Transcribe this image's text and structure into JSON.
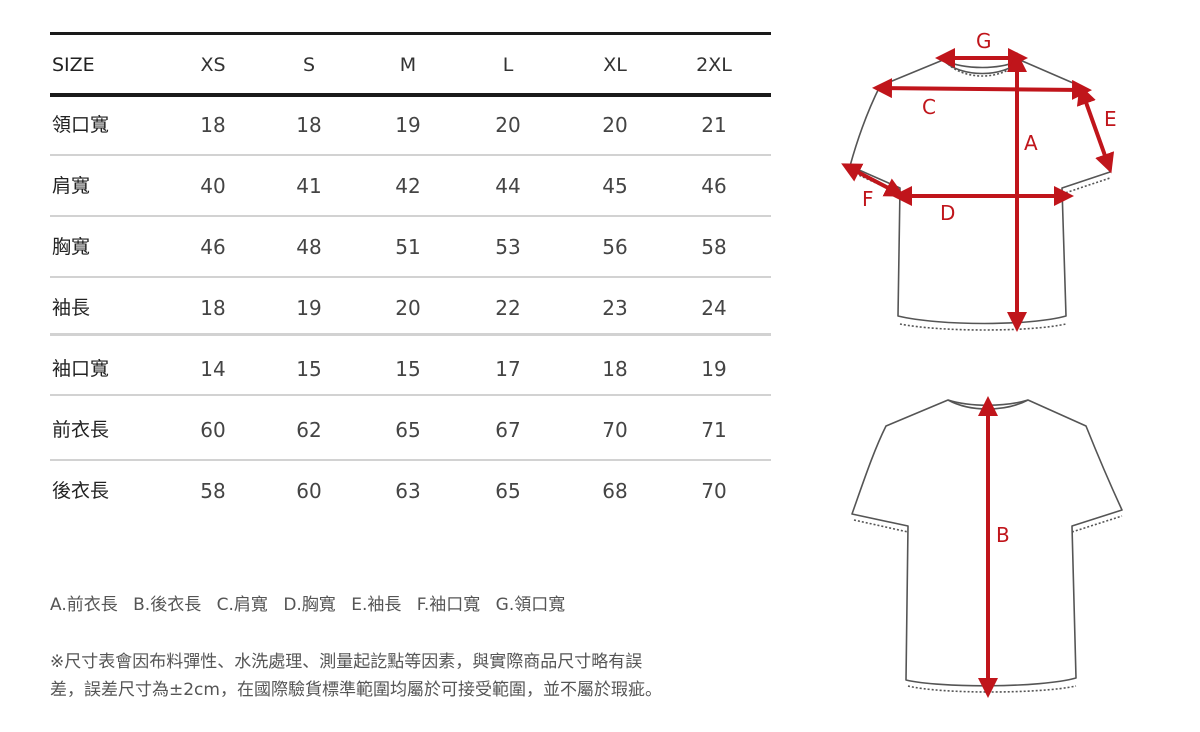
{
  "size_chart": {
    "header": {
      "label": "SIZE",
      "sizes": [
        "XS",
        "S",
        "M",
        "L",
        "XL",
        "2XL"
      ]
    },
    "rows": [
      {
        "label": "領口寬",
        "values": [
          "18",
          "18",
          "19",
          "20",
          "20",
          "21"
        ]
      },
      {
        "label": "肩寬",
        "values": [
          "40",
          "41",
          "42",
          "44",
          "45",
          "46"
        ]
      },
      {
        "label": "胸寬",
        "values": [
          "46",
          "48",
          "51",
          "53",
          "56",
          "58"
        ]
      },
      {
        "label": "袖長",
        "values": [
          "18",
          "19",
          "20",
          "22",
          "23",
          "24"
        ]
      },
      {
        "label": "袖口寬",
        "values": [
          "14",
          "15",
          "15",
          "17",
          "18",
          "19"
        ]
      },
      {
        "label": "前衣長",
        "values": [
          "60",
          "62",
          "65",
          "67",
          "70",
          "71"
        ]
      },
      {
        "label": "後衣長",
        "values": [
          "58",
          "60",
          "63",
          "65",
          "68",
          "70"
        ]
      }
    ]
  },
  "legend": [
    "A.前衣長",
    "B.後衣長",
    "C.肩寬",
    "D.胸寬",
    "E.袖長",
    "F.袖口寬",
    "G.領口寬"
  ],
  "note": {
    "line1": "※尺寸表會因布料彈性、水洗處理、測量起訖點等因素，與實際商品尺寸略有誤",
    "line2": "差，誤差尺寸為±2cm，在國際驗貨標準範圍均屬於可接受範圍，並不屬於瑕疵。"
  },
  "diagram": {
    "front_labels": {
      "a": "A",
      "c": "C",
      "d": "D",
      "e": "E",
      "f": "F",
      "g": "G"
    },
    "back_labels": {
      "b": "B"
    },
    "colors": {
      "measure": "#c0151b",
      "outline": "#555555"
    }
  }
}
